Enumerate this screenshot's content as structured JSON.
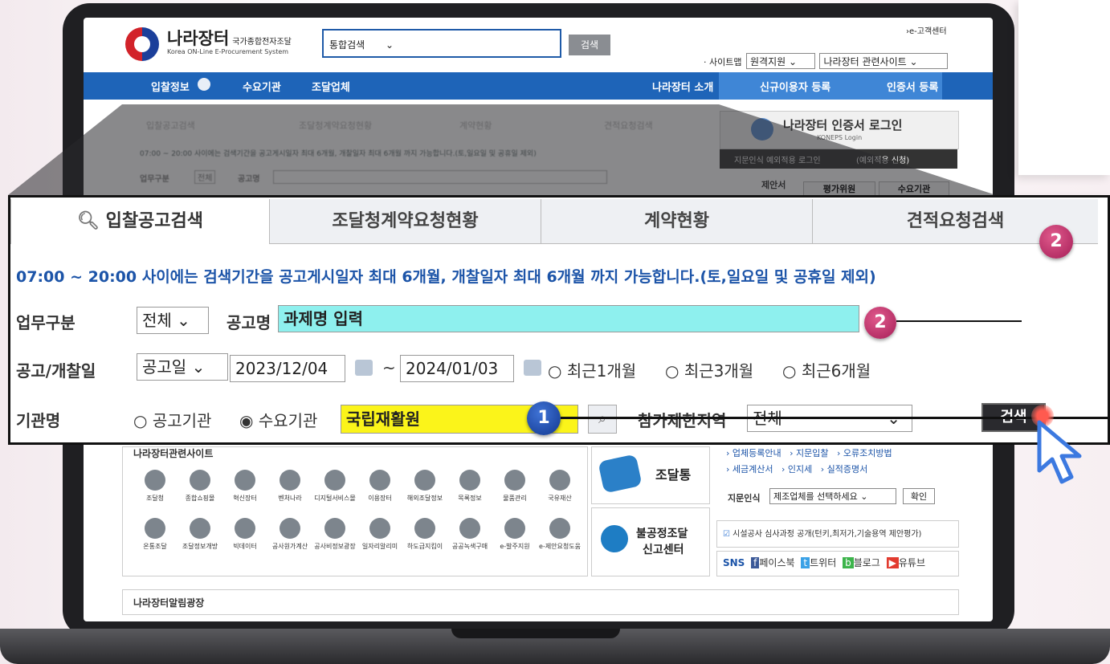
{
  "header": {
    "brand": "나라장터",
    "brand_sub": "국가종합전자조달",
    "brand_en": "Korea ON-Line E-Procurement System",
    "search_select": "통합검색",
    "search_button": "검색",
    "ecustomer": "›e-고객센터",
    "sitemap_label": "· 사이트맵",
    "remote_select": "원격지원",
    "related_select": "나라장터 관련사이트"
  },
  "nav": {
    "items": [
      "입찰정보",
      "수요기관",
      "조달업체",
      "나라장터 소개",
      "신규이용자 등록",
      "인증서 등록"
    ]
  },
  "background": {
    "tabs": [
      "입찰공고검색",
      "조달청계약요청현황",
      "계약현황",
      "견적요청검색"
    ],
    "notice": "07:00 ~ 20:00 사이에는 검색기간을 공고게시일자 최대 6개월, 개찰일자 최대 6개월 까지 가능합니다.(토,일요일 및 공휴일 제외)",
    "work_label": "업무구분",
    "work_value": "전체",
    "title_label": "공고명",
    "login_title": "나라장터 인증서 로그인",
    "login_sub": "KONEPS Login",
    "fingerprint": "지문인식 예외적용 로그인",
    "fingerprint_apply": "(예외적용 신청)",
    "proposal": "제안서",
    "evaluator": "평가위원",
    "demand": "수요기관"
  },
  "zoom": {
    "tabs": [
      "입찰공고검색",
      "조달청계약요청현황",
      "계약현황",
      "견적요청검색"
    ],
    "notice": "07:00 ~ 20:00 사이에는 검색기간을 공고게시일자 최대 6개월, 개찰일자 최대 6개월 까지 가능합니다.(토,일요일 및 공휴일 제외)",
    "work_label": "업무구분",
    "work_value": "전체",
    "title_label": "공고명",
    "title_value": "과제명 입력",
    "date_label": "공고/개찰일",
    "date_type": "공고일",
    "date_from": "2023/12/04",
    "tilde": "~",
    "date_to": "2024/01/03",
    "radio1": "최근1개월",
    "radio2": "최근3개월",
    "radio3": "최근6개월",
    "org_label": "기관명",
    "org_radio1": "공고기관",
    "org_radio2": "수요기관",
    "org_value": "국립재활원",
    "region_label": "참가제한지역",
    "region_value": "전체",
    "search_button": "검색"
  },
  "badges": {
    "one": "1",
    "two": "2"
  },
  "lower": {
    "related_title": "나라장터관련사이트",
    "icons_row1": [
      "조달청",
      "종합쇼핑몰",
      "혁신장터",
      "벤처나라",
      "디지털서비스몰",
      "이용장터",
      "해외조달정보",
      "목록정보",
      "물품관리",
      "국유재산"
    ],
    "icons_row2": [
      "온통조달",
      "조달정보개방",
      "빅데이터",
      "공사원가계산",
      "공사비정보광장",
      "일자리알리미",
      "하도급지킴이",
      "공공녹색구매",
      "e-발주지원",
      "e-제안요청도움"
    ],
    "jodaltong": "조달통",
    "unfair_line1": "불공정조달",
    "unfair_line2": "신고센터",
    "links1": [
      "› 업체등록안내",
      "› 지문입찰",
      "› 오류조치방법"
    ],
    "links2": [
      "› 세금계산서",
      "› 인지세",
      "› 실적증명서"
    ],
    "fingerprint_label": "지문인식",
    "fingerprint_select": "제조업체를 선택하세요",
    "confirm": "확인",
    "facility": "시설공사 심사과정 공개(턴키,최저가,기술용역 제안평가)",
    "sns": "SNS",
    "facebook": "페이스북",
    "twitter": "트위터",
    "blog": "블로그",
    "youtube": "유튜브",
    "notice_square": "나라장터알림광장"
  }
}
